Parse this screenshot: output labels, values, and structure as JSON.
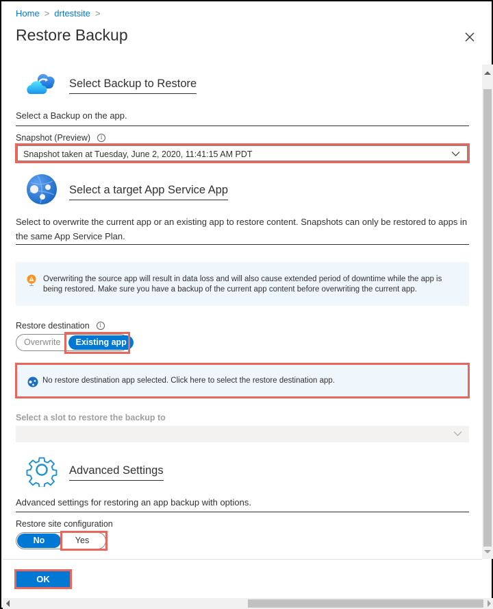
{
  "breadcrumb": [
    {
      "label": "Home"
    },
    {
      "label": "drtestsite"
    }
  ],
  "breadcrumb_separator": ">",
  "page_title": "Restore Backup",
  "close_icon": "close-icon",
  "sections": {
    "backup": {
      "icon": "cloud-backup-icon",
      "title": "Select Backup to Restore",
      "description": "Select a Backup on the app.",
      "snapshot_label": "Snapshot (Preview)",
      "snapshot_value": "Snapshot taken at Tuesday, June 2, 2020, 11:41:15 AM PDT"
    },
    "target": {
      "icon": "app-service-globe-icon",
      "title": "Select a target App Service App",
      "description": "Select to overwrite the current app or an existing app to restore content. Snapshots can only be restored to apps in the same App Service Plan.",
      "warning": "Overwriting the source app will result in data loss and will also cause extended period of downtime while the app is being restored. Make sure you have a backup of the current app content before overwriting the current app.",
      "restore_destination_label": "Restore destination",
      "restore_destination_options": [
        "Overwrite",
        "Existing app"
      ],
      "restore_destination_selected": "Existing app",
      "destination_message": "No restore destination app selected. Click here to select the restore destination app.",
      "slot_label": "Select a slot to restore the backup to",
      "slot_value": ""
    },
    "advanced": {
      "icon": "gear-icon",
      "title": "Advanced Settings",
      "description": "Advanced settings for restoring an app backup with options.",
      "restore_site_config_label": "Restore site configuration",
      "restore_site_config_options": [
        "No",
        "Yes"
      ],
      "restore_site_config_selected": "No"
    }
  },
  "footer": {
    "ok_label": "OK"
  },
  "colors": {
    "accent": "#0078d4",
    "highlight_box": "#e8665c",
    "info_background": "#eff6fc",
    "warning_icon": "#f7941d"
  }
}
